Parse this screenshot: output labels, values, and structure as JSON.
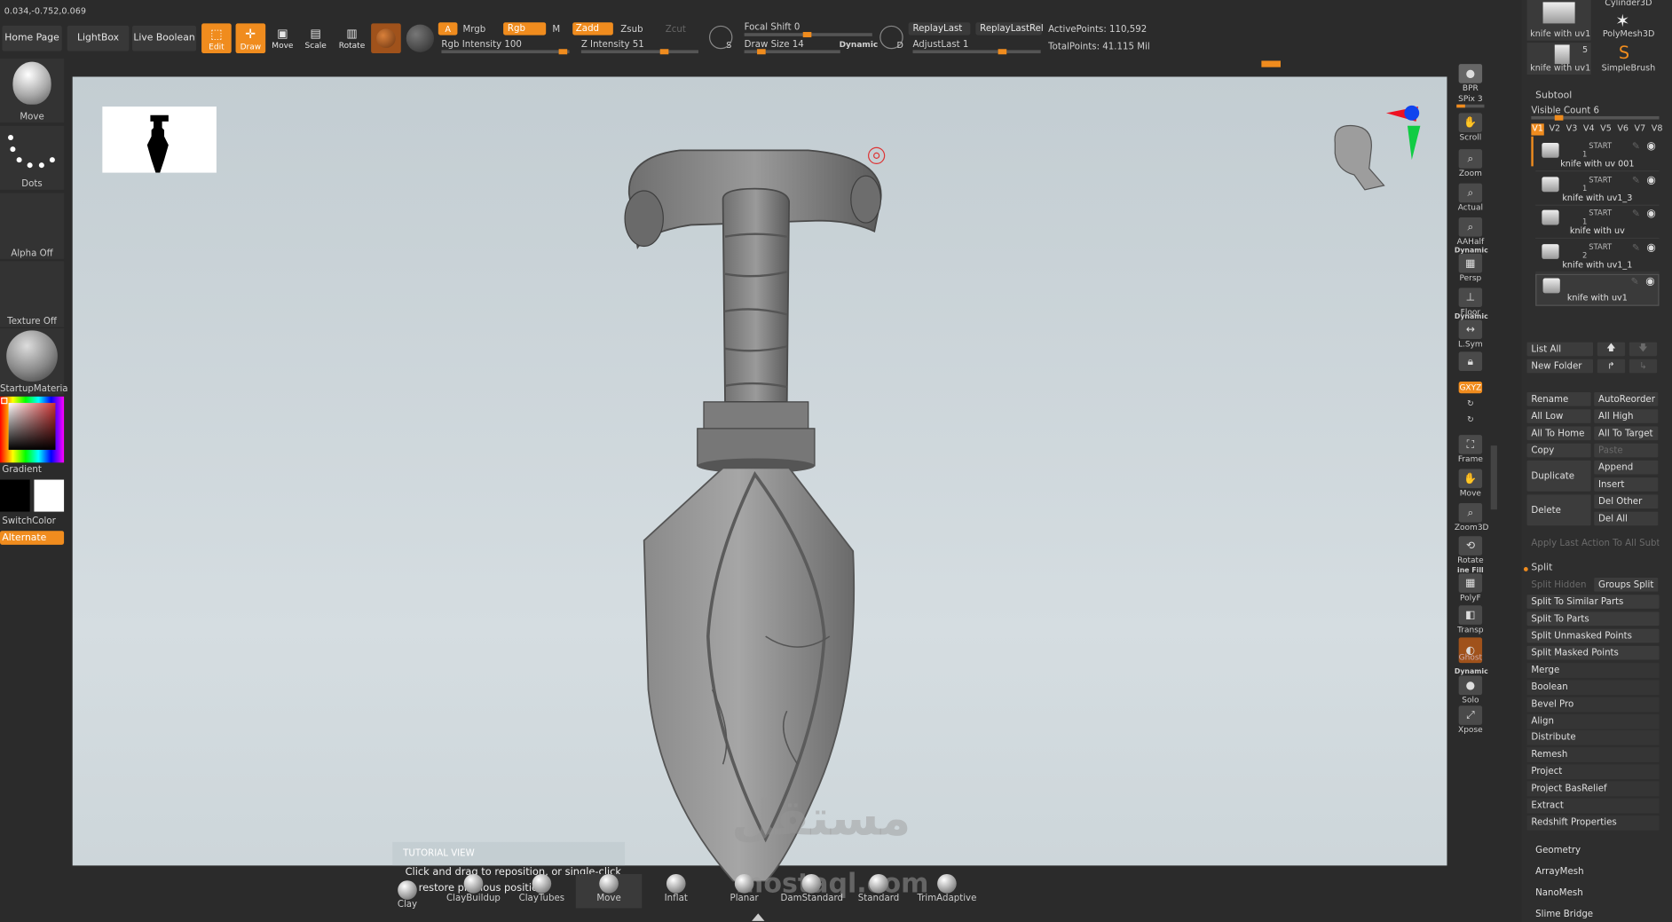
{
  "coords": "0.034,-0.752,0.069",
  "top_buttons": {
    "home_page": "Home Page",
    "lightbox": "LightBox",
    "live_boolean": "Live Boolean"
  },
  "modes": {
    "edit": "Edit",
    "draw": "Draw",
    "move": "Move",
    "scale": "Scale",
    "rotate": "Rotate"
  },
  "color_toggles": {
    "a": "A",
    "mrgb": "Mrgb",
    "rgb": "Rgb",
    "m": "M",
    "zadd": "Zadd",
    "zsub": "Zsub",
    "zcut": "Zcut"
  },
  "sliders": {
    "rgb_intensity": "Rgb Intensity 100",
    "z_intensity": "Z Intensity 51",
    "focal_shift": "Focal Shift 0",
    "draw_size": "Draw Size 14",
    "dynamic": "Dynamic",
    "adjust_last": "AdjustLast 1"
  },
  "replay": {
    "replay_last": "ReplayLast",
    "replay_last_rel": "ReplayLastRel"
  },
  "stats": {
    "active_points": "ActivePoints: 110,592",
    "total_points": "TotalPoints: 41.115 Mil"
  },
  "left_panel": {
    "move": "Move",
    "dots": "Dots",
    "alpha_off": "Alpha Off",
    "texture_off": "Texture Off",
    "startup_material": "StartupMateria",
    "gradient": "Gradient",
    "switch_color": "SwitchColor",
    "alternate": "Alternate"
  },
  "shelf": {
    "bpr": "BPR",
    "spix": "SPix 3",
    "scroll": "Scroll",
    "zoom": "Zoom",
    "actual": "Actual",
    "aahalf": "AAHalf",
    "dynamic": "Dynamic",
    "persp": "Persp",
    "floor": "Floor",
    "dynamic2": "Dynamic",
    "lsym": "L.Sym",
    "xyz": "GXYZ",
    "frame": "Frame",
    "move": "Move",
    "zoom3d": "Zoom3D",
    "rotate": "Rotate",
    "linefill": "ine Fill",
    "polyf": "PolyF",
    "transp": "Transp",
    "ghost": "Ghost",
    "dynamic3": "Dynamic",
    "solo": "Solo",
    "xpose": "Xpose"
  },
  "tool_thumbs": {
    "cylinder3d": "Cylinder3D",
    "knife_uv1_a": "knife with uv1",
    "polymesh3d": "PolyMesh3D",
    "knife_uv1_b": "knife with uv1",
    "count": "5",
    "simplebrush": "SimpleBrush"
  },
  "subtool": {
    "header": "Subtool",
    "visible_count": "Visible Count 6",
    "versions": [
      "V1",
      "V2",
      "V3",
      "V4",
      "V5",
      "V6",
      "V7",
      "V8"
    ],
    "start": "START",
    "items": [
      {
        "name": "knife with uv 001",
        "num": "1"
      },
      {
        "name": "knife with uv1_3",
        "num": "1"
      },
      {
        "name": "knife with uv",
        "num": "1"
      },
      {
        "name": "knife with uv1_1",
        "num": "2"
      },
      {
        "name": "knife with uv1",
        "num": ""
      }
    ],
    "list_all": "List All",
    "new_folder": "New Folder",
    "rename": "Rename",
    "auto_reorder": "AutoReorder",
    "all_low": "All Low",
    "all_high": "All High",
    "all_to_home": "All To Home",
    "all_to_target": "All To Target",
    "copy": "Copy",
    "paste": "Paste",
    "duplicate": "Duplicate",
    "append": "Append",
    "insert": "Insert",
    "delete": "Delete",
    "del_other": "Del Other",
    "del_all": "Del All",
    "apply_last": "Apply Last Action To All Subtoo"
  },
  "split": {
    "header": "Split",
    "split_hidden": "Split Hidden",
    "groups_split": "Groups Split",
    "similar": "Split To Similar Parts",
    "parts": "Split To Parts",
    "unmasked": "Split Unmasked Points",
    "masked": "Split Masked Points"
  },
  "menu_items": [
    "Merge",
    "Boolean",
    "Bevel Pro",
    "Align",
    "Distribute",
    "Remesh",
    "Project",
    "Project BasRelief",
    "Extract",
    "Redshift Properties"
  ],
  "lower_menu": [
    "Geometry",
    "ArrayMesh",
    "NanoMesh",
    "Slime Bridge"
  ],
  "brushes": [
    "Clay",
    "ClayBuildup",
    "ClayTubes",
    "Move",
    "Inflat",
    "Planar",
    "DamStandard",
    "Standard",
    "TrimAdaptive"
  ],
  "tutorial": {
    "title": "TUTORIAL VIEW",
    "line1": "Click and drag to reposition, or single-click",
    "line2": "to restore previous position."
  },
  "watermark": {
    "arabic": "مستقل",
    "latin": "mostaql.com"
  },
  "colors": {
    "accent": "#f08c1e",
    "background": "#2b2b2b",
    "viewport": "#c8d1d6"
  }
}
